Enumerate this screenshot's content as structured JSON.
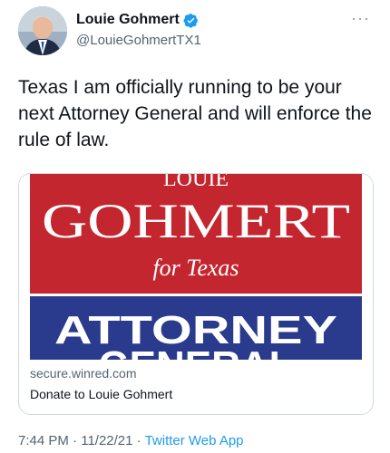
{
  "author": {
    "display_name": "Louie Gohmert",
    "handle": "@LouieGohmertTX1",
    "verified": true
  },
  "tweet": {
    "text": "Texas I am officially running to be your next Attorney General and will enforce the rule of law."
  },
  "card": {
    "banner_top_fragment": "LOUIE",
    "banner_name": "GOHMERT",
    "banner_tagline": "for Texas",
    "banner_office": "ATTORNEY",
    "banner_office_2": "GENERAL",
    "domain": "secure.winred.com",
    "title": "Donate to Louie Gohmert"
  },
  "meta": {
    "time": "7:44 PM",
    "date": "11/22/21",
    "separator": "·",
    "source": "Twitter Web App"
  },
  "colors": {
    "banner_red": "#c3262f",
    "banner_blue": "#2a3a8c",
    "verified_blue": "#1d9bf0",
    "link_blue": "#1d9bf0"
  },
  "icons": {
    "verified": "verified-badge-icon",
    "more": "more-options-icon"
  }
}
